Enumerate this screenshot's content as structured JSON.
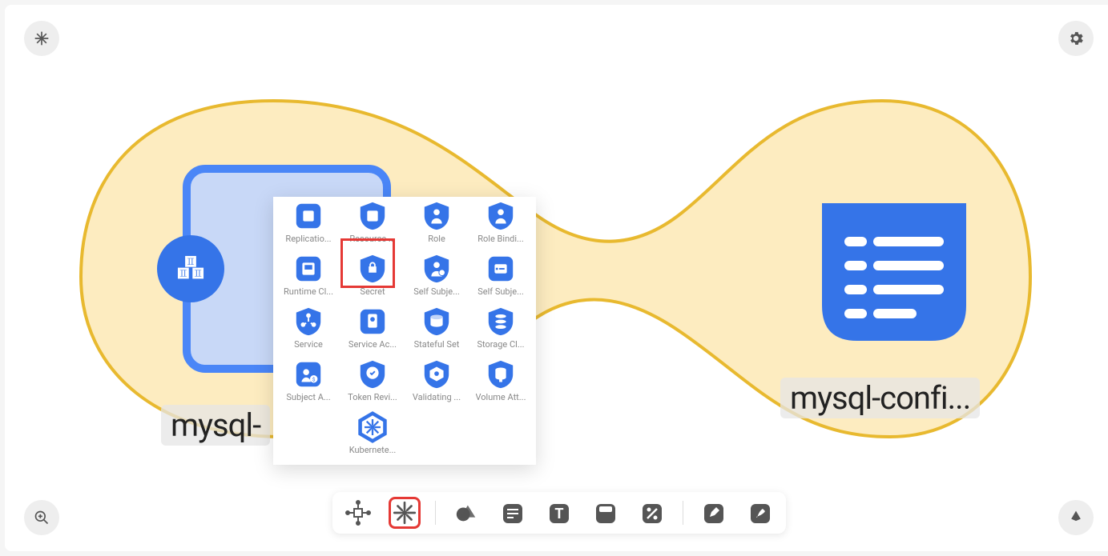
{
  "colors": {
    "primary": "#3574e8",
    "primary_light": "#4a86f7",
    "blob_fill": "#fdecc0",
    "blob_stroke": "#e8b92f",
    "highlight": "#e53935",
    "dark_btn": "#555555"
  },
  "corner_buttons": {
    "tl": "freeze-icon",
    "tr": "settings-icon",
    "bl": "zoom-in-icon",
    "br": "pen-tool-icon"
  },
  "nodes": {
    "left": {
      "label": "mysql-"
    },
    "right": {
      "label": "mysql-confi..."
    }
  },
  "palette": {
    "selected_index": 5,
    "items": [
      {
        "label": "Replicatio...",
        "icon": "replication-controller-icon",
        "shape": "rounded"
      },
      {
        "label": "Resource ...",
        "icon": "resource-quota-icon",
        "shape": "shield"
      },
      {
        "label": "Role",
        "icon": "role-icon",
        "shape": "shield"
      },
      {
        "label": "Role Bindi...",
        "icon": "role-binding-icon",
        "shape": "shield"
      },
      {
        "label": "Runtime Cl...",
        "icon": "runtime-class-icon",
        "shape": "rounded"
      },
      {
        "label": "Secret",
        "icon": "secret-icon",
        "shape": "shield"
      },
      {
        "label": "Self Subje...",
        "icon": "self-subject-access-icon",
        "shape": "shield"
      },
      {
        "label": "Self Subje...",
        "icon": "self-subject-rules-icon",
        "shape": "rounded"
      },
      {
        "label": "Service",
        "icon": "service-icon",
        "shape": "shield"
      },
      {
        "label": "Service Ac...",
        "icon": "service-account-icon",
        "shape": "rounded"
      },
      {
        "label": "Stateful Set",
        "icon": "stateful-set-icon",
        "shape": "shield"
      },
      {
        "label": "Storage Cl...",
        "icon": "storage-class-icon",
        "shape": "shield"
      },
      {
        "label": "Subject A...",
        "icon": "subject-access-icon",
        "shape": "rounded"
      },
      {
        "label": "Token Revi...",
        "icon": "token-review-icon",
        "shape": "shield"
      },
      {
        "label": "Validating ...",
        "icon": "validating-webhook-icon",
        "shape": "shield"
      },
      {
        "label": "Volume Att...",
        "icon": "volume-attachment-icon",
        "shape": "shield"
      },
      {
        "label": "",
        "icon": "",
        "shape": ""
      },
      {
        "label": "Kubernete...",
        "icon": "kubernetes-icon",
        "shape": "hex"
      }
    ]
  },
  "toolbar": {
    "selected_index": 1,
    "buttons": [
      {
        "name": "system-icon",
        "dark": false
      },
      {
        "name": "kubernetes-helm-icon",
        "dark": false
      },
      {
        "name": "shapes-icon",
        "dark": false
      },
      {
        "name": "comment-icon",
        "dark": true
      },
      {
        "name": "text-icon",
        "dark": true
      },
      {
        "name": "card-icon",
        "dark": true
      },
      {
        "name": "percent-icon",
        "dark": true
      },
      {
        "name": "pen-icon",
        "dark": true
      },
      {
        "name": "marker-icon",
        "dark": true
      }
    ]
  }
}
